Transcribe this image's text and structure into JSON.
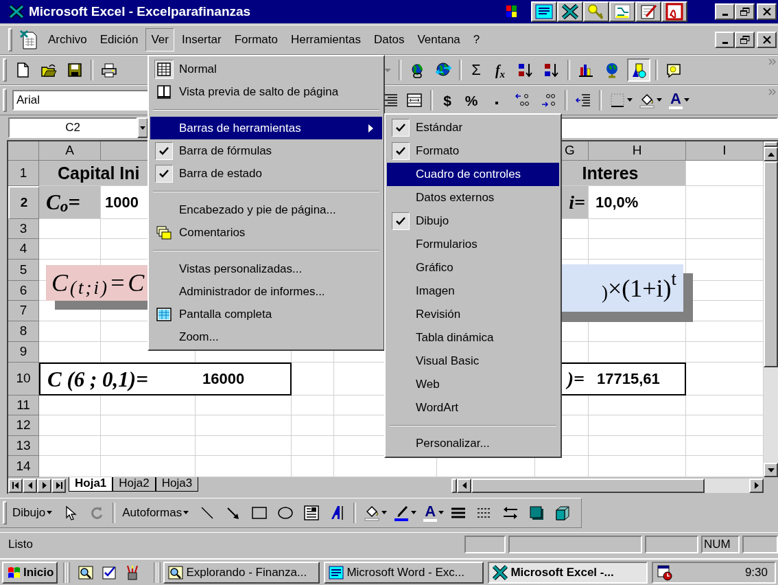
{
  "window": {
    "title": "Microsoft Excel - Excelparafinanzas"
  },
  "menu_bar": [
    {
      "label": "Archivo",
      "selected": false
    },
    {
      "label": "Edición",
      "selected": false
    },
    {
      "label": "Ver",
      "selected": true
    },
    {
      "label": "Insertar",
      "selected": false
    },
    {
      "label": "Formato",
      "selected": false
    },
    {
      "label": "Herramientas",
      "selected": false
    },
    {
      "label": "Datos",
      "selected": false
    },
    {
      "label": "Ventana",
      "selected": false
    },
    {
      "label": "?",
      "selected": false
    }
  ],
  "standard_toolbar": {
    "sum_button": "Σ",
    "function_button": "f$_{x}$"
  },
  "formatting_toolbar": {
    "font_field": "Arial",
    "currency_button": "$",
    "percent_button": "%",
    "font_color_button": "A"
  },
  "name_box": "C2",
  "column_headers": [
    "A",
    "G",
    "H",
    "I"
  ],
  "row_headers": [
    {
      "label": "1",
      "selected": false
    },
    {
      "label": "2",
      "selected": true
    },
    {
      "label": "3",
      "selected": false
    },
    {
      "label": "4",
      "selected": false
    },
    {
      "label": "5",
      "selected": false
    },
    {
      "label": "6",
      "selected": false
    },
    {
      "label": "7",
      "selected": false
    },
    {
      "label": "8",
      "selected": false
    },
    {
      "label": "9",
      "selected": false
    },
    {
      "label": "10",
      "selected": false
    },
    {
      "label": "11",
      "selected": false
    },
    {
      "label": "12",
      "selected": false
    },
    {
      "label": "13",
      "selected": false
    },
    {
      "label": "14",
      "selected": false
    }
  ],
  "cells": [
    {
      "text": "Capital Ini"
    },
    {
      "text": "C$_{o}$="
    },
    {
      "text": "1000"
    },
    {
      "text": "Interes"
    },
    {
      "text": "i="
    },
    {
      "text": "10,0%"
    },
    {
      "text": "C (6 ; 0,1)="
    },
    {
      "text": "16000"
    },
    {
      "text": ")="
    },
    {
      "text": "17715,61"
    }
  ],
  "equation_images": [
    {
      "text": "C$_{(t;i)}$=C"
    },
    {
      "text": "$_{)}$×(1+i)$^{t}$"
    }
  ],
  "view_menu": [
    {
      "kind": "item",
      "label": "Normal",
      "checked": true,
      "selected": false
    },
    {
      "kind": "item",
      "label": "Vista previa de salto de página",
      "checked": false,
      "selected": false
    },
    {
      "kind": "separator"
    },
    {
      "kind": "submenu",
      "label": "Barras de herramientas",
      "checked": false,
      "selected": true
    },
    {
      "kind": "item",
      "label": "Barra de fórmulas",
      "checked": true,
      "selected": false
    },
    {
      "kind": "item",
      "label": "Barra de estado",
      "checked": true,
      "selected": false
    },
    {
      "kind": "separator"
    },
    {
      "kind": "item",
      "label": "Encabezado y pie de página...",
      "checked": false,
      "selected": false
    },
    {
      "kind": "item",
      "label": "Comentarios",
      "checked": false,
      "selected": false
    },
    {
      "kind": "separator"
    },
    {
      "kind": "item",
      "label": "Vistas personalizadas...",
      "checked": false,
      "selected": false
    },
    {
      "kind": "item",
      "label": "Administrador de informes...",
      "checked": false,
      "selected": false
    },
    {
      "kind": "item",
      "label": "Pantalla completa",
      "checked": false,
      "selected": false
    },
    {
      "kind": "item",
      "label": "Zoom...",
      "checked": false,
      "selected": false
    }
  ],
  "toolbars_submenu": [
    {
      "kind": "item",
      "label": "Estándar",
      "checked": true,
      "selected": false
    },
    {
      "kind": "item",
      "label": "Formato",
      "checked": true,
      "selected": false
    },
    {
      "kind": "item",
      "label": "Cuadro de controles",
      "checked": false,
      "selected": true
    },
    {
      "kind": "item",
      "label": "Datos externos",
      "checked": false,
      "selected": false
    },
    {
      "kind": "item",
      "label": "Dibujo",
      "checked": true,
      "selected": false
    },
    {
      "kind": "item",
      "label": "Formularios",
      "checked": false,
      "selected": false
    },
    {
      "kind": "item",
      "label": "Gráfico",
      "checked": false,
      "selected": false
    },
    {
      "kind": "item",
      "label": "Imagen",
      "checked": false,
      "selected": false
    },
    {
      "kind": "item",
      "label": "Revisión",
      "checked": false,
      "selected": false
    },
    {
      "kind": "item",
      "label": "Tabla dinámica",
      "checked": false,
      "selected": false
    },
    {
      "kind": "item",
      "label": "Visual Basic",
      "checked": false,
      "selected": false
    },
    {
      "kind": "item",
      "label": "Web",
      "checked": false,
      "selected": false
    },
    {
      "kind": "item",
      "label": "WordArt",
      "checked": false,
      "selected": false
    },
    {
      "kind": "separator"
    },
    {
      "kind": "item",
      "label": "Personalizar...",
      "checked": false,
      "selected": false
    }
  ],
  "sheet_tabs": [
    {
      "label": "Hoja1",
      "selected": true
    },
    {
      "label": "Hoja2",
      "selected": false
    },
    {
      "label": "Hoja3",
      "selected": false
    }
  ],
  "drawing_toolbar": {
    "draw_menu": "Dibujo",
    "autoshapes_menu": "Autoformas",
    "font_color_button": "A"
  },
  "status_bar": {
    "message": "Listo",
    "indicator": "NUM"
  },
  "taskbar": {
    "start_button": "Inicio",
    "tasks": [
      {
        "label": "Explorando - Finanza...",
        "selected": false
      },
      {
        "label": "Microsoft Word - Exc...",
        "selected": false
      },
      {
        "label": "Microsoft Excel -...",
        "selected": true
      }
    ],
    "clock": "9:30"
  }
}
